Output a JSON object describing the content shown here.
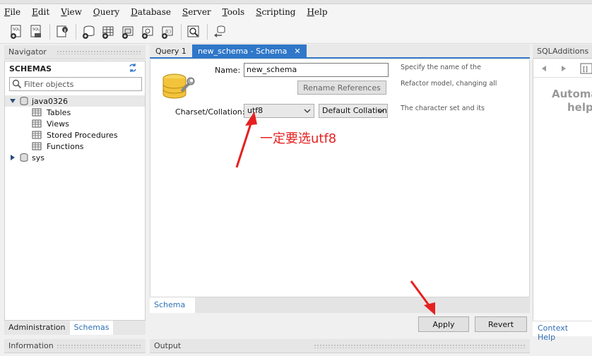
{
  "menu": [
    "File",
    "Edit",
    "View",
    "Query",
    "Database",
    "Server",
    "Tools",
    "Scripting",
    "Help"
  ],
  "toolbar_icons": [
    "new-sql-tab-icon",
    "open-sql-file-icon",
    "inspector-icon",
    "create-schema-icon",
    "create-table-icon",
    "create-view-icon",
    "create-procedure-icon",
    "create-function-icon",
    "search-table-icon",
    "reconnect-icon"
  ],
  "navigator": {
    "header": "Navigator",
    "schemas_title": "SCHEMAS",
    "filter_placeholder": "Filter objects",
    "tree": {
      "db1": "java0326",
      "children": [
        "Tables",
        "Views",
        "Stored Procedures",
        "Functions"
      ],
      "db2": "sys"
    },
    "tabs": [
      "Administration",
      "Schemas"
    ],
    "info_header": "Information"
  },
  "editor": {
    "tabs": [
      "Query 1",
      "new_schema - Schema"
    ],
    "name_label": "Name:",
    "name_value": "new_schema",
    "rename_button": "Rename References",
    "charset_label": "Charset/Collation:",
    "charset_value": "utf8",
    "collation_value": "Default Collation",
    "help_name_line1": "Specify the name of the",
    "help_name_line2": "Refactor model, changing all",
    "help_charset": "The character set and its",
    "annotation": "一定要选utf8",
    "bottom_tab": "Schema",
    "apply_button": "Apply",
    "revert_button": "Revert",
    "output_header": "Output"
  },
  "sqladditions": {
    "header": "SQLAdditions",
    "text_line1": "Automa",
    "text_line2": "help",
    "context_help": "Context Help"
  },
  "colors": {
    "accent": "#2f77c8",
    "annotation": "#e62020"
  }
}
